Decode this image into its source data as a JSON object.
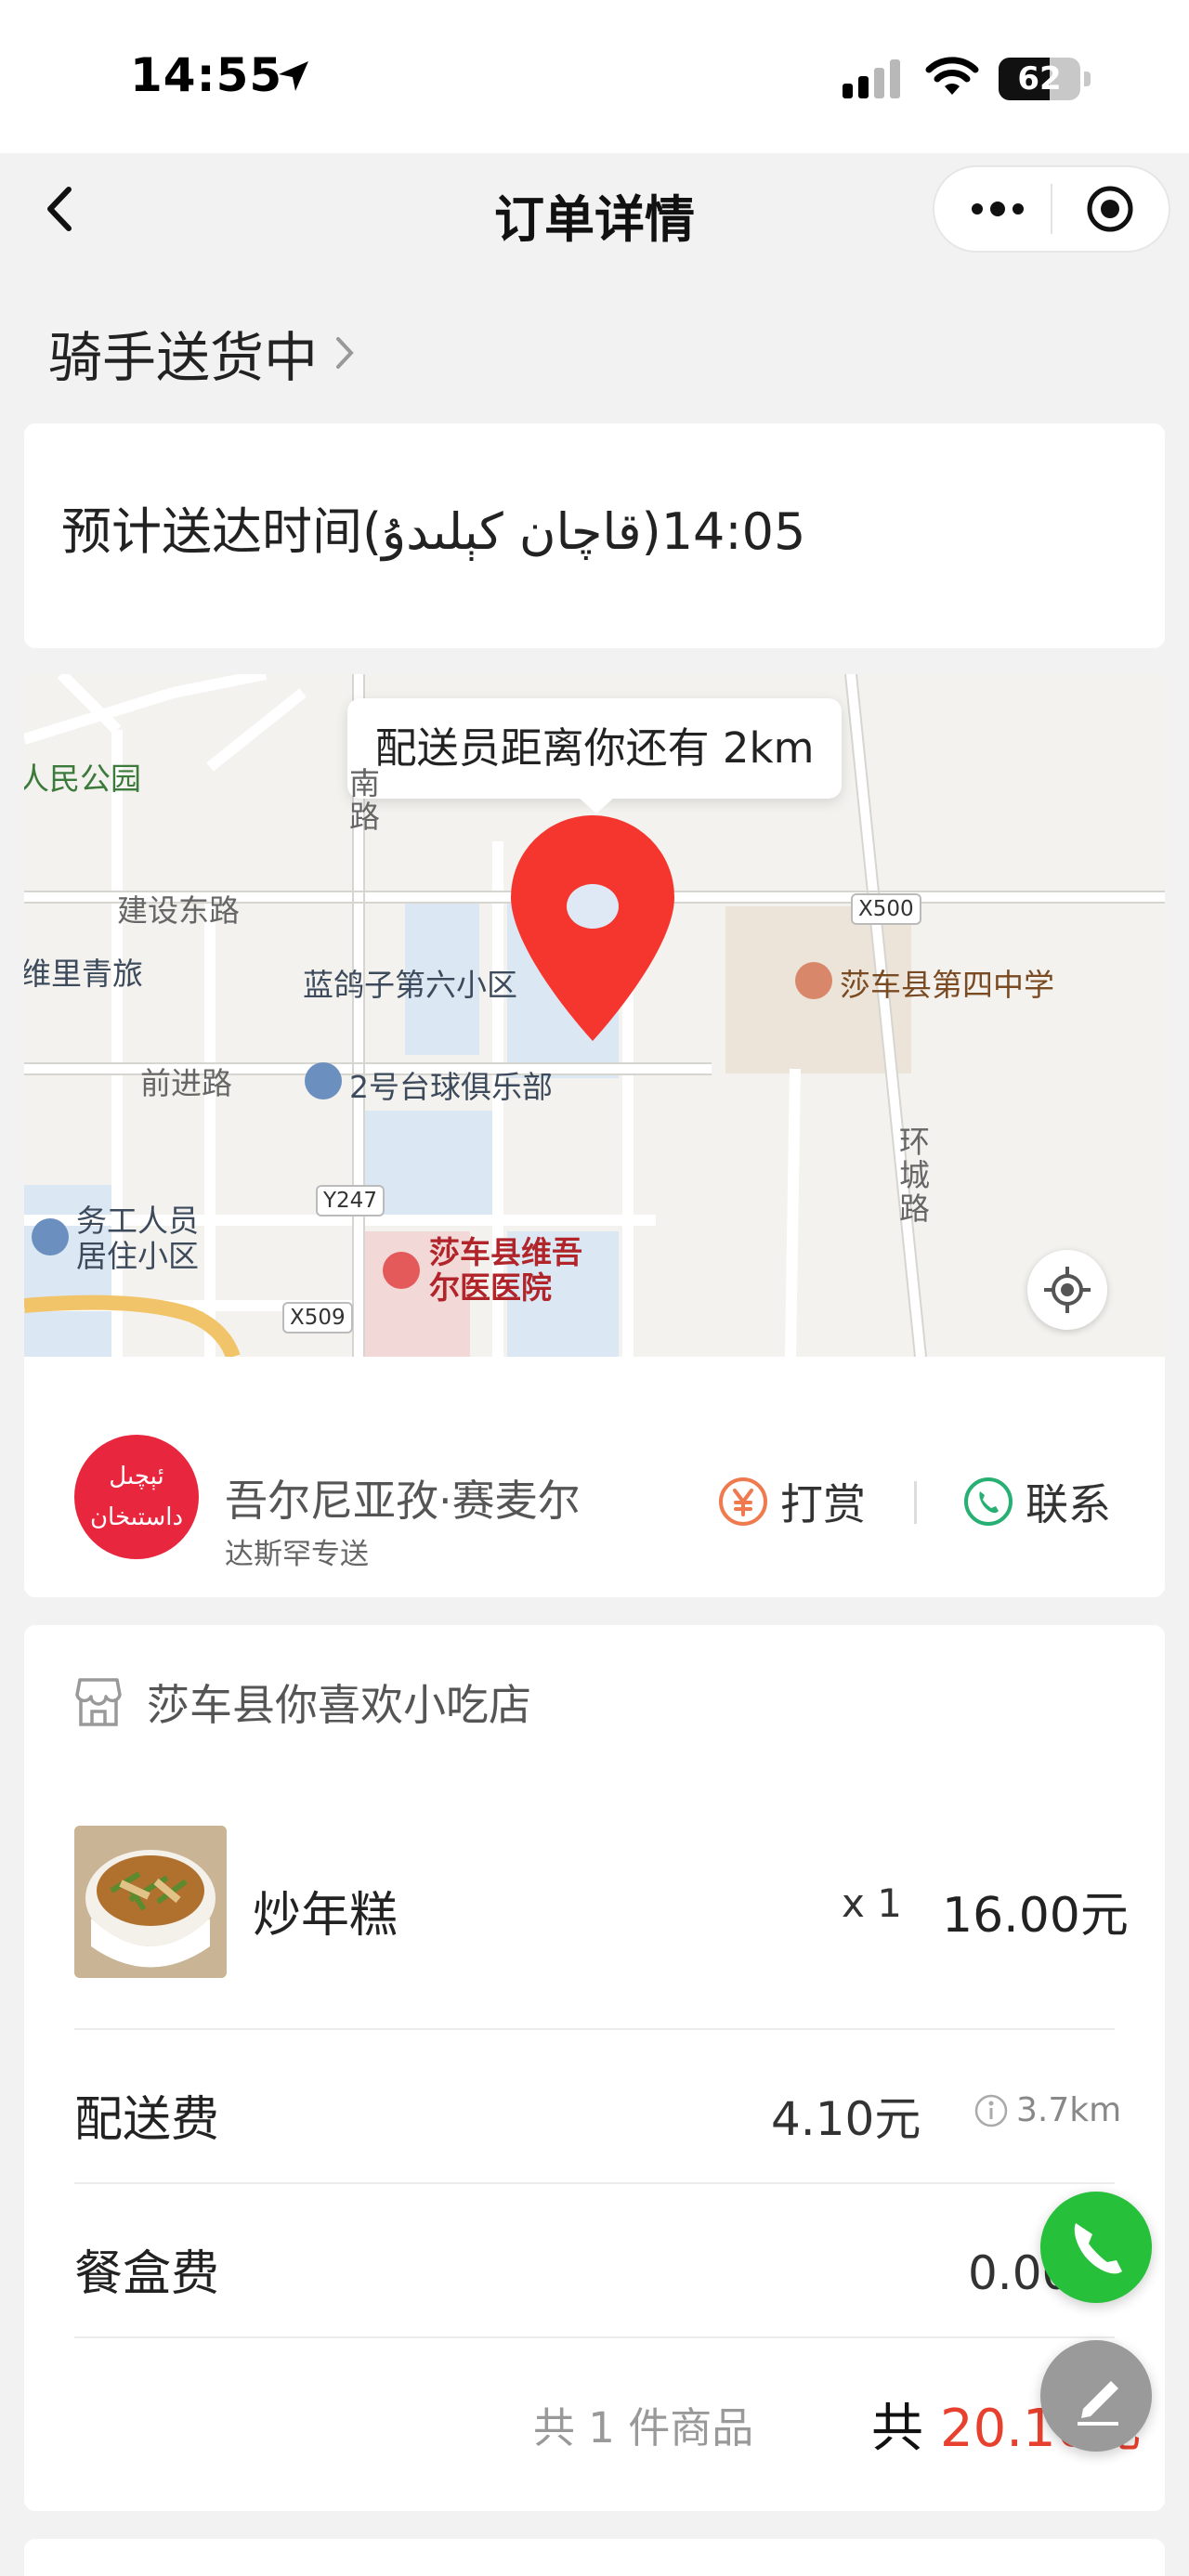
{
  "status_bar": {
    "time": "14:55",
    "battery": "62",
    "battery_level": 0.62
  },
  "nav": {
    "title": "订单详情"
  },
  "order_status": {
    "label": "骑手送货中"
  },
  "eta": {
    "text": "预计送达时间(قاچان كېلىدۇ)14:05"
  },
  "map": {
    "tooltip": "配送员距离你还有 2km",
    "labels": {
      "park": "人民公园",
      "jianshe": "建设东路",
      "youth_hostel": "维里青旅",
      "lanzi": "蓝鸽子第六小区",
      "qianjin": "前进路",
      "billiards": "2号台球俱乐部",
      "wugong": "务工人员\n居住小区",
      "hospital": "莎车县维吾\n尔医医院",
      "school": "莎车县第四中学",
      "huancheng": "环\n城\n路",
      "nan": "南\n路",
      "x500": "X500",
      "y247": "Y247",
      "x509": "X509"
    }
  },
  "rider": {
    "logo_line1": "ئېچىل",
    "logo_line2": "داستىخان",
    "name": "吾尔尼亚孜·赛麦尔",
    "service": "达斯罕专送",
    "tip_label": "打赏",
    "contact_label": "联系"
  },
  "order": {
    "shop_name": "莎车县你喜欢小吃店",
    "items": [
      {
        "name": "炒年糕",
        "qty": "x 1",
        "price": "16.00元"
      }
    ],
    "delivery_fee_label": "配送费",
    "delivery_fee": "4.10元",
    "distance": "3.7km",
    "box_fee_label": "餐盒费",
    "box_fee": "0.00元",
    "count_text": "共 1 件商品",
    "total_prefix": "共",
    "total": "20.10元"
  },
  "colors": {
    "accent_red": "#e8402e",
    "call_green": "#27c03a",
    "pin_red": "#f5362f",
    "logo_red": "#e8263e"
  }
}
